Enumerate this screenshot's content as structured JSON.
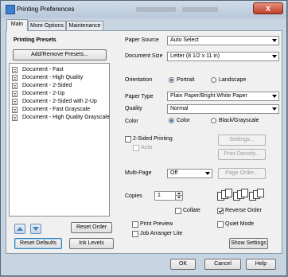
{
  "window": {
    "title": "Printing Preferences",
    "close_label": "X"
  },
  "tabs": [
    {
      "label": "Main"
    },
    {
      "label": "More Options"
    },
    {
      "label": "Maintenance"
    }
  ],
  "presets": {
    "heading": "Printing Presets",
    "add_remove_label": "Add/Remove Presets...",
    "items": [
      "Document - Fast",
      "Document - High Quality",
      "Document - 2-Sided",
      "Document - 2-Up",
      "Document - 2-Sided with 2-Up",
      "Document - Fast Grayscale",
      "Document - High Quality Grayscale"
    ],
    "reset_order_label": "Reset Order"
  },
  "settings": {
    "paper_source": {
      "label": "Paper Source",
      "value": "Auto Select"
    },
    "document_size": {
      "label": "Document Size",
      "value": "Letter (8 1/2 x 11 in)"
    },
    "orientation": {
      "label": "Orientation",
      "portrait": "Portrait",
      "landscape": "Landscape",
      "selected": "Portrait"
    },
    "paper_type": {
      "label": "Paper Type",
      "value": "Plain Paper/Bright White Paper"
    },
    "quality": {
      "label": "Quality",
      "value": "Normal"
    },
    "color": {
      "label": "Color",
      "color": "Color",
      "bw": "Black/Grayscale",
      "selected": "Color"
    },
    "two_sided": {
      "label": "2-Sided Printing",
      "auto": "Auto",
      "settings_label": "Settings...",
      "density_label": "Print Density..."
    },
    "multi_page": {
      "label": "Multi-Page",
      "value": "Off",
      "page_order_label": "Page Order..."
    },
    "copies": {
      "label": "Copies",
      "value": "1",
      "collate": "Collate",
      "reverse_order": "Reverse Order"
    },
    "print_preview": "Print Preview",
    "quiet_mode": "Quiet Mode",
    "job_arranger": "Job Arranger Lite",
    "show_settings_label": "Show Settings"
  },
  "footer": {
    "reset_defaults_label": "Reset Defaults",
    "ink_levels_label": "Ink Levels",
    "ok_label": "OK",
    "cancel_label": "Cancel",
    "help_label": "Help"
  }
}
